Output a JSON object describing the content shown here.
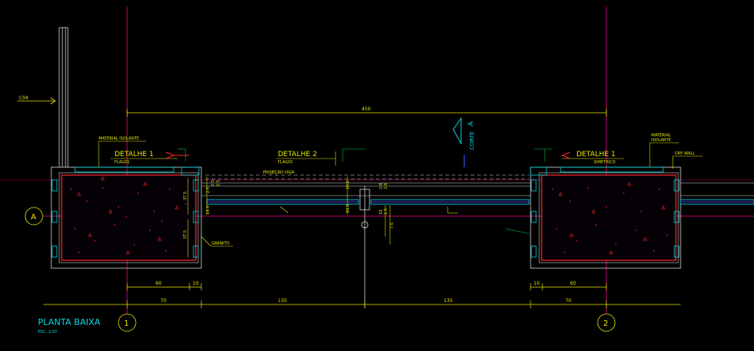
{
  "drawing": {
    "title": "PLANTA BAIXA",
    "scale": "ESC. 1/20",
    "left_callout": "C04",
    "section_label": "CORTE",
    "section_letter": "A"
  },
  "grid": {
    "row_a": "A",
    "col_1": "1",
    "col_2": "2"
  },
  "details": {
    "d1_left": {
      "title": "DETALHE 1",
      "sub": "FLAG01"
    },
    "d2": {
      "title": "DETALHE 2",
      "sub": "FLAG01"
    },
    "d1_right": {
      "title": "DETALHE 1",
      "sub": "SIMETRICO"
    }
  },
  "annotations": {
    "material_isolante_left": "MATERIAL ISOLANTE",
    "material_isolante_right_1": "MATERIAL",
    "material_isolante_right_2": "ISOLANTE",
    "dry_wall": "DRY WALL",
    "projecao_viga": "PROJEÇÃO VIGA",
    "granito": "GRANITO"
  },
  "dimensions": {
    "top_span": "450",
    "left_60": "60",
    "left_10": "10",
    "right_10": "10",
    "right_60": "60",
    "bot_70_left": "70",
    "bot_135_left": "135",
    "bot_135_right": "135",
    "bot_70_right": "70",
    "v_37_5_top": "37.5",
    "v_37_5_bot": "37.5",
    "v_14_4": "14.4",
    "v_2_5a": "2.5",
    "v_2_5b": "2.5",
    "v_2_5c": "2.5",
    "v_10_5": "10.5",
    "v_10_5b": "10.5",
    "v_2_8": "2.8",
    "v_2_6": "2.6",
    "v_1_5": "1.5",
    "v_10": "10",
    "v_7_5": "7.5"
  },
  "colors": {
    "background": "#000000",
    "grid_line": "#c0006a",
    "dimension": "#e6e600",
    "text_cyan": "#00d8e0",
    "wall_red": "#ff2a2a",
    "white_line": "#d8d8d8",
    "green_leader": "#00cc44"
  }
}
